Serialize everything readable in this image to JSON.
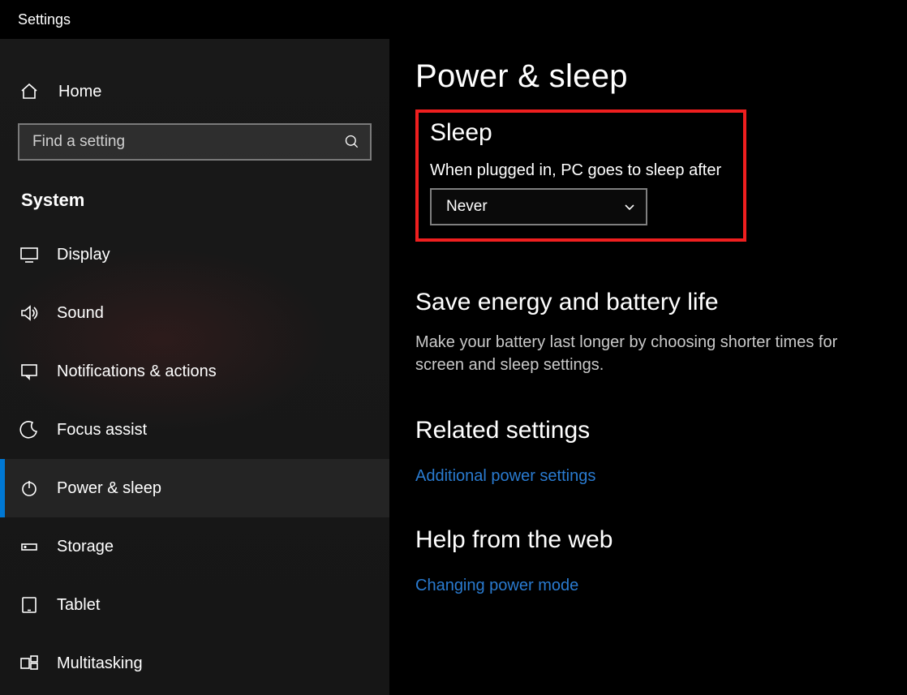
{
  "window": {
    "title": "Settings"
  },
  "sidebar": {
    "home": "Home",
    "search_placeholder": "Find a setting",
    "category": "System",
    "items": [
      {
        "label": "Display",
        "icon": "display-icon",
        "active": false
      },
      {
        "label": "Sound",
        "icon": "sound-icon",
        "active": false
      },
      {
        "label": "Notifications & actions",
        "icon": "notifications-icon",
        "active": false
      },
      {
        "label": "Focus assist",
        "icon": "focus-assist-icon",
        "active": false
      },
      {
        "label": "Power & sleep",
        "icon": "power-icon",
        "active": true
      },
      {
        "label": "Storage",
        "icon": "storage-icon",
        "active": false
      },
      {
        "label": "Tablet",
        "icon": "tablet-icon",
        "active": false
      },
      {
        "label": "Multitasking",
        "icon": "multitasking-icon",
        "active": false
      }
    ]
  },
  "main": {
    "page_title": "Power & sleep",
    "sleep": {
      "heading": "Sleep",
      "label": "When plugged in, PC goes to sleep after",
      "value": "Never"
    },
    "energy": {
      "heading": "Save energy and battery life",
      "text": "Make your battery last longer by choosing shorter times for screen and sleep settings."
    },
    "related": {
      "heading": "Related settings",
      "link1": "Additional power settings"
    },
    "help": {
      "heading": "Help from the web",
      "link1": "Changing power mode"
    }
  }
}
